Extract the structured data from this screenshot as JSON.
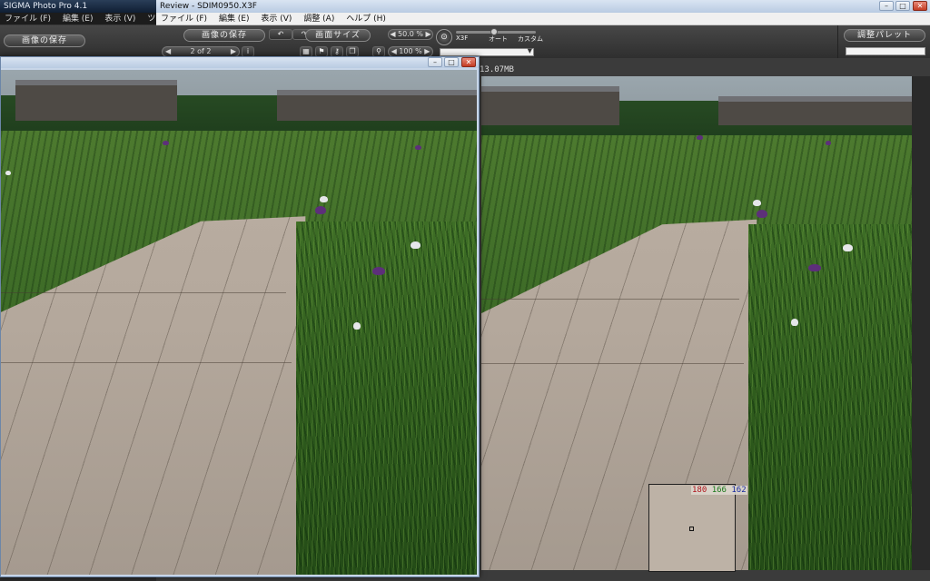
{
  "sigma_app": {
    "title": "SIGMA Photo Pro 4.1",
    "menu": [
      "ファイル (F)",
      "編集 (E)",
      "表示 (V)",
      "ツール (T)"
    ],
    "save_label": "画像の保存"
  },
  "review_window": {
    "title": "Review - SDIM0950.X3F",
    "menu": [
      "ファイル (F)",
      "編集 (E)",
      "表示 (V)",
      "調整 (A)",
      "ヘルプ (H)"
    ],
    "save_label": "画像の保存",
    "screen_size_label": "画面サイズ",
    "zoom_top": "50.0 %",
    "zoom_bottom": "100 %",
    "page_counter": "2 of 2",
    "mode_labels": [
      "X3F",
      "オート",
      "カスタム"
    ],
    "adjust_palette_label": "調整パレット",
    "file_size": "13.07MB"
  },
  "loupe": {
    "r": "180",
    "g": "166",
    "b": "162",
    "r_color": "#b0141c",
    "g_color": "#1c7a1c",
    "b_color": "#1c2ca0"
  },
  "icons": [
    "info-icon",
    "rotate-left-icon",
    "rotate-right-icon",
    "flag-icon",
    "key-icon",
    "copy-icon",
    "search-icon",
    "minimize-icon",
    "maximize-icon",
    "close-icon"
  ]
}
